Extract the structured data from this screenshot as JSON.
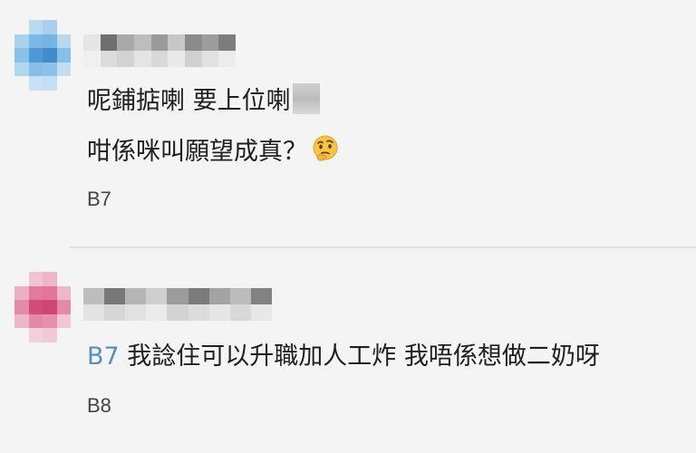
{
  "comments": [
    {
      "line1": "呢鋪掂喇 要上位喇",
      "line2": "咁係咪叫願望成真？",
      "emoji": "thinking-face-icon",
      "floor": "B7",
      "avatar_color": "#5aa0d8"
    },
    {
      "reply_to": "B7",
      "text": "我諗住可以升職加人工炸 我唔係想做二奶呀",
      "floor": "B8",
      "avatar_color": "#d8557f"
    }
  ],
  "colors": {
    "background": "#f4f4f4",
    "reply_tag": "#5a8dc0",
    "divider": "#e2e2e2"
  }
}
